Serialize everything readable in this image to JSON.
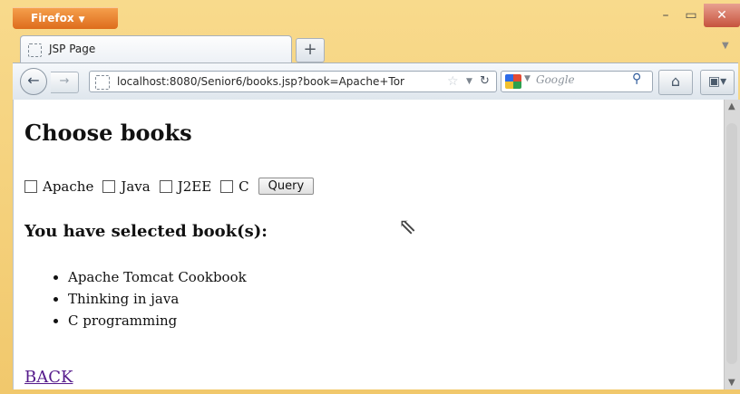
{
  "browser": {
    "menu_label": "Firefox",
    "tab_title": "JSP Page",
    "url": "localhost:8080/Senior6/books.jsp?book=Apache+Tor",
    "search_placeholder": "Google"
  },
  "page": {
    "heading": "Choose books",
    "options": [
      "Apache",
      "Java",
      "J2EE",
      "C"
    ],
    "query_label": "Query",
    "selected_heading": "You have selected book(s):",
    "selected_books": [
      "Apache Tomcat Cookbook",
      "Thinking in java",
      "C programming"
    ],
    "back_link": "BACK"
  },
  "colors": {
    "firefox_button": "#e8762b",
    "link_visited": "#551a8b",
    "frame": "#f4ce7a"
  }
}
